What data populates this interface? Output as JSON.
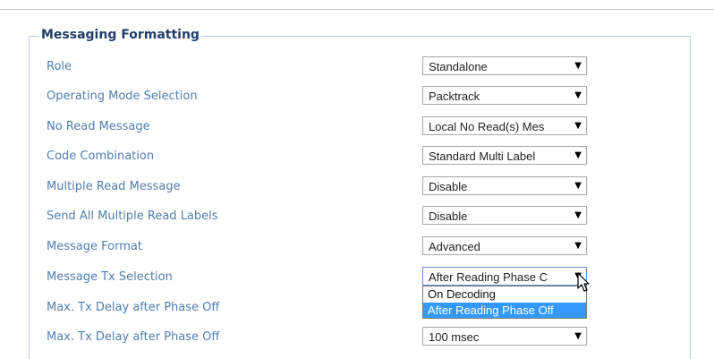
{
  "section": {
    "title": "Messaging Formatting"
  },
  "rows": [
    {
      "label": "Role",
      "value": "Standalone"
    },
    {
      "label": "Operating Mode Selection",
      "value": "Packtrack"
    },
    {
      "label": "No Read Message",
      "value": "Local No Read(s) Mes"
    },
    {
      "label": "Code Combination",
      "value": "Standard Multi Label"
    },
    {
      "label": "Multiple Read Message",
      "value": "Disable"
    },
    {
      "label": "Send All Multiple Read Labels",
      "value": "Disable"
    },
    {
      "label": "Message Format",
      "value": "Advanced"
    },
    {
      "label": "Message Tx Selection",
      "value": "After Reading Phase C"
    },
    {
      "label": "Max. Tx Delay after Phase Off",
      "value": ""
    },
    {
      "label": "Max. Tx Delay after Phase Off",
      "value": "100 msec"
    }
  ],
  "dropdown": {
    "options": [
      "On Decoding",
      "After Reading Phase Off"
    ],
    "selected": "After Reading Phase Off"
  },
  "icons": {
    "arrow": "dropdown-arrow-icon",
    "cursor": "mouse-pointer-icon"
  }
}
